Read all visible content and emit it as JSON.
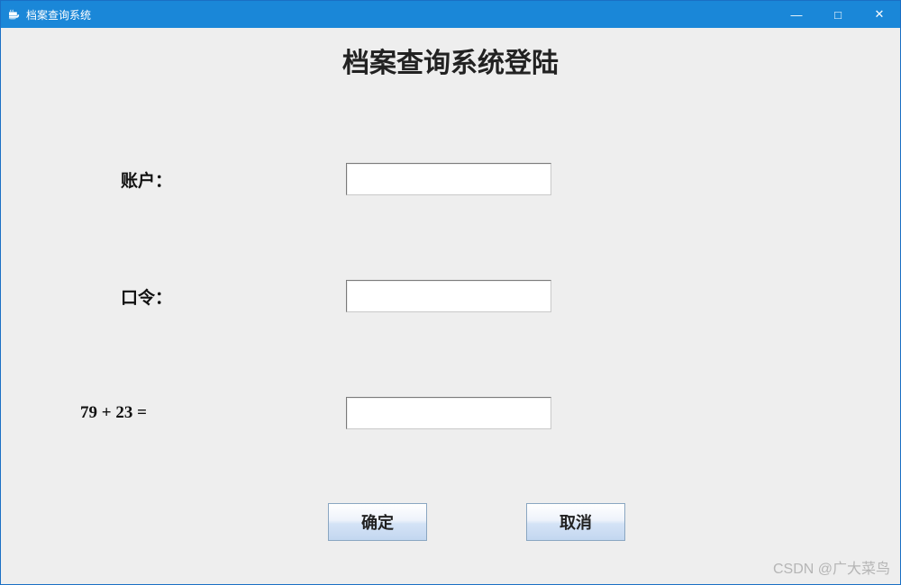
{
  "window": {
    "title": "档案查询系统",
    "controls": {
      "minimize": "—",
      "maximize": "□",
      "close": "✕"
    }
  },
  "heading": "档案查询系统登陆",
  "form": {
    "account": {
      "label": "账户：",
      "value": ""
    },
    "password": {
      "label": "口令：",
      "value": ""
    },
    "captcha": {
      "label": "79 + 23 =",
      "value": ""
    }
  },
  "buttons": {
    "ok": "确定",
    "cancel": "取消"
  },
  "watermark": "CSDN @广大菜鸟"
}
